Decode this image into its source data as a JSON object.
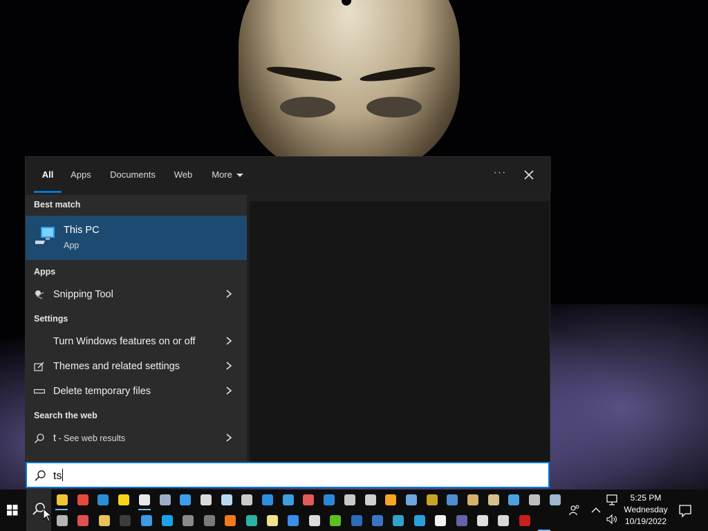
{
  "search_panel": {
    "tabs": [
      "All",
      "Apps",
      "Documents",
      "Web",
      "More"
    ],
    "best_match": {
      "header": "Best match",
      "name": "This PC",
      "type": "App"
    },
    "apps": {
      "header": "Apps",
      "items": [
        "Snipping Tool"
      ]
    },
    "settings": {
      "header": "Settings",
      "items": [
        "Turn Windows features on or off",
        "Themes and related settings",
        "Delete temporary files"
      ]
    },
    "web": {
      "header": "Search the web",
      "query": "t",
      "suffix": " - See web results"
    }
  },
  "search_box": {
    "value": "ts"
  },
  "taskbar": {
    "time": "5:25 PM",
    "day": "Wednesday",
    "date": "10/19/2022",
    "icons_row1": [
      "file-explorer",
      "chrome",
      "photos",
      "sticky-notes",
      "settings",
      "weather",
      "internet-explorer",
      "paint",
      "notepad",
      "paint-3d",
      "remote-desktop",
      "task-manager",
      "3d-viewer",
      "microsoft-store-grid",
      "snip",
      "printer",
      "media-player",
      "wordpad",
      "steam",
      "control-panel",
      "scanner",
      "archive",
      "magnifier",
      "accessibility",
      "computer-management"
    ],
    "icons_row2": [
      "disk-cleanup",
      "roblox-studio",
      "folder-tools",
      "command-prompt",
      "remote-desktop-connection",
      "cortana",
      "calculator",
      "camera",
      "firefox",
      "edge",
      "notes",
      "roblox",
      "windows-security",
      "xbox-game-bar",
      "powershell",
      "windows-powershell",
      "powershell-ise",
      "azure-cloud-shell",
      "microsoft-store",
      "teams",
      "tiktok",
      "roblox-player",
      "flash"
    ],
    "accent_color": "#0078d4"
  }
}
